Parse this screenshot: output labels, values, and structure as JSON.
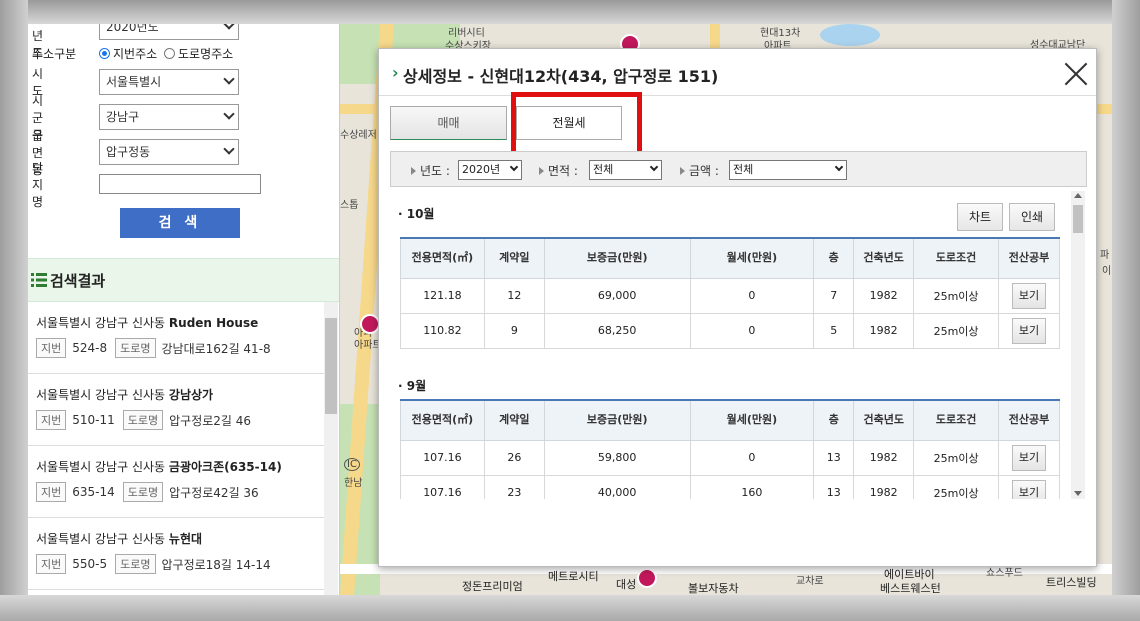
{
  "left_panel": {
    "year_label": "기준년도",
    "year_value": "2020년도",
    "address_type_label": "주소구분",
    "address_options": [
      "지번주소",
      "도로명주소"
    ],
    "sido_label": "시도",
    "sido_value": "서울특별시",
    "sigungu_label": "시군구",
    "sigungu_value": "강남구",
    "dong_label": "읍면동",
    "dong_value": "압구정동",
    "complex_label": "단지명",
    "complex_value": "",
    "search_button": "검 색",
    "results_title": "검색결과",
    "results": [
      {
        "address": "서울특별시 강남구 신사동",
        "name": "Ruden House",
        "jibun_tag": "지번",
        "jibun": "524-8",
        "road_tag": "도로명",
        "road": "강남대로162길 41-8"
      },
      {
        "address": "서울특별시 강남구 신사동",
        "name": "강남상가",
        "jibun_tag": "지번",
        "jibun": "510-11",
        "road_tag": "도로명",
        "road": "압구정로2길 46"
      },
      {
        "address": "서울특별시 강남구 신사동",
        "name": "금광아크존(635-14)",
        "jibun_tag": "지번",
        "jibun": "635-14",
        "road_tag": "도로명",
        "road": "압구정로42길 36"
      },
      {
        "address": "서울특별시 강남구 신사동",
        "name": "뉴현대",
        "jibun_tag": "지번",
        "jibun": "550-5",
        "road_tag": "도로명",
        "road": "압구정로18길 14-14"
      }
    ]
  },
  "map": {
    "labels": [
      "리버시티",
      "수상스키장",
      "현대13차",
      "아파트",
      "성수대교남단",
      "수상레저",
      "스톱",
      "아파",
      "아파트",
      "IC",
      "한남",
      "정돈프리미엄",
      "메트로시티",
      "대성",
      "볼보자동차",
      "에이트바이",
      "베스트웨스턴",
      "트리스빌딩",
      "쇼스푸드",
      "교차로",
      "파",
      "이"
    ]
  },
  "modal": {
    "title": "상세정보 - 신현대12차(434, 압구정로 151)",
    "tabs": [
      "매매",
      "전월세"
    ],
    "filters": {
      "year_label": "년도 :",
      "year_value": "2020년",
      "area_label": "면적 :",
      "area_value": "전체",
      "amount_label": "금액 :",
      "amount_value": "전체"
    },
    "chart_button": "차트",
    "print_button": "인쇄",
    "columns": [
      "전용면적(㎡)",
      "계약일",
      "보증금(만원)",
      "월세(만원)",
      "층",
      "건축년도",
      "도로조건",
      "전산공부"
    ],
    "sections": [
      {
        "month": "· 10월",
        "rows": [
          [
            "121.18",
            "12",
            "69,000",
            "0",
            "7",
            "1982",
            "25m이상",
            "보기"
          ],
          [
            "110.82",
            "9",
            "68,250",
            "0",
            "5",
            "1982",
            "25m이상",
            "보기"
          ]
        ]
      },
      {
        "month": "· 9월",
        "rows": [
          [
            "107.16",
            "26",
            "59,800",
            "0",
            "13",
            "1982",
            "25m이상",
            "보기"
          ],
          [
            "107.16",
            "23",
            "40,000",
            "160",
            "13",
            "1982",
            "25m이상",
            "보기"
          ]
        ]
      }
    ]
  }
}
